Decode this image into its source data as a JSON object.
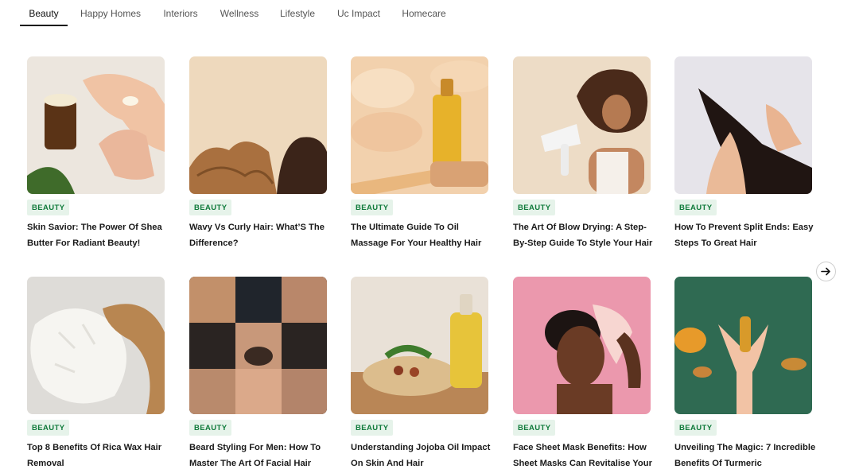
{
  "tabs": [
    {
      "label": "Beauty",
      "active": true
    },
    {
      "label": "Happy Homes",
      "active": false
    },
    {
      "label": "Interiors",
      "active": false
    },
    {
      "label": "Wellness",
      "active": false
    },
    {
      "label": "Lifestyle",
      "active": false
    },
    {
      "label": "Uc Impact",
      "active": false
    },
    {
      "label": "Homecare",
      "active": false
    }
  ],
  "articles": [
    {
      "category": "BEAUTY",
      "title": "Skin Savior: The Power Of Shea Butter For Radiant Beauty!"
    },
    {
      "category": "BEAUTY",
      "title": "Wavy Vs Curly Hair: What’S The Difference?"
    },
    {
      "category": "BEAUTY",
      "title": "The Ultimate Guide To Oil Massage For Your Healthy Hair"
    },
    {
      "category": "BEAUTY",
      "title": "The Art Of Blow Drying: A Step-By-Step Guide To Style Your Hair"
    },
    {
      "category": "BEAUTY",
      "title": "How To Prevent Split Ends: Easy Steps To Great Hair"
    },
    {
      "category": "BEAUTY",
      "title": "Top 8 Benefits Of Rica Wax Hair Removal"
    },
    {
      "category": "BEAUTY",
      "title": "Beard Styling For Men: How To Master The Art Of Facial Hair"
    },
    {
      "category": "BEAUTY",
      "title": "Understanding Jojoba Oil Impact On Skin And Hair"
    },
    {
      "category": "BEAUTY",
      "title": "Face Sheet Mask Benefits: How Sheet Masks Can Revitalise Your"
    },
    {
      "category": "BEAUTY",
      "title": "Unveiling The Magic: 7 Incredible Benefits Of Turmeric"
    }
  ],
  "colors": {
    "badge_bg": "#e6f3ea",
    "badge_text": "#0f7a3a",
    "active_tab_underline": "#111111"
  },
  "icons": {
    "next": "arrow-right-icon"
  }
}
